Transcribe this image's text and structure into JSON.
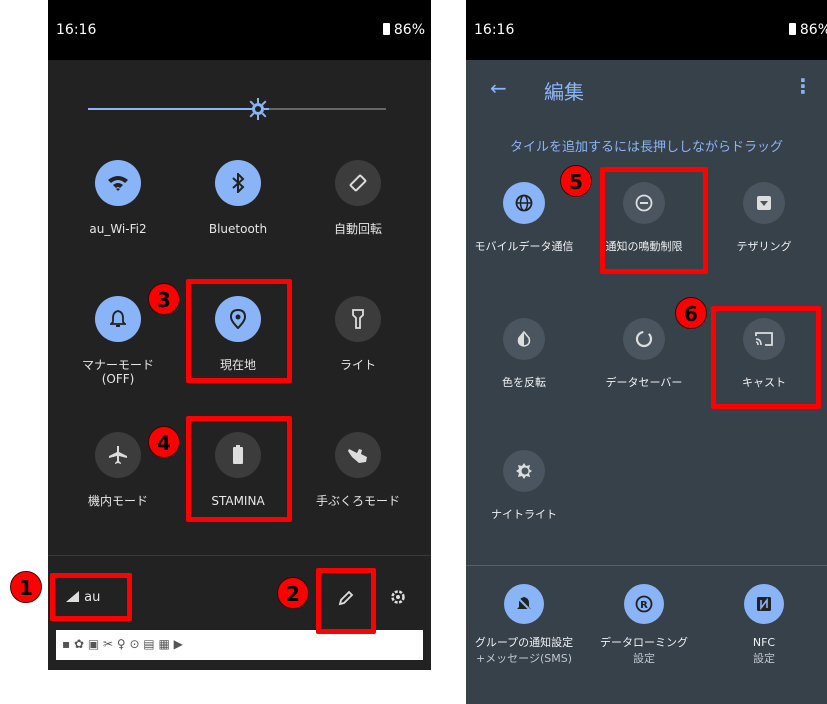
{
  "colors": {
    "accent": "#8ab4f8",
    "highlight": "#ff0000",
    "left_bg": "#222222",
    "right_bg": "#37414a"
  },
  "left_screen": {
    "status": {
      "time": "16:16",
      "battery": "86%"
    },
    "brightness_level_percent": 57,
    "tiles": [
      {
        "label": "au_Wi-Fi2",
        "icon": "wifi-icon",
        "active": true
      },
      {
        "label": "Bluetooth",
        "icon": "bluetooth-icon",
        "active": true
      },
      {
        "label": "自動回転",
        "icon": "auto-rotate-icon",
        "active": false
      },
      {
        "label": "マナーモード",
        "label2": "(OFF)",
        "icon": "bell-icon",
        "active": true
      },
      {
        "label": "現在地",
        "icon": "location-icon",
        "active": true
      },
      {
        "label": "ライト",
        "icon": "flashlight-icon",
        "active": false
      },
      {
        "label": "機内モード",
        "icon": "airplane-icon",
        "active": false
      },
      {
        "label": "STAMINA",
        "icon": "battery-icon",
        "active": false
      },
      {
        "label": "手ぶくろモード",
        "icon": "glove-icon",
        "active": false
      }
    ],
    "carrier": "au",
    "notif_icons": "▪ ✿ ▣ ✂ ♀ ⊙ ▤ ▦ ▶"
  },
  "right_screen": {
    "status": {
      "time": "16:16",
      "battery": "86%"
    },
    "title": "編集",
    "back": "←",
    "menu": "⋮",
    "hint": "タイルを追加するには長押ししながらドラッグ",
    "tiles": [
      {
        "label": "モバイルデータ通信",
        "icon": "globe-icon",
        "active": true
      },
      {
        "label": "通知の鳴動制限",
        "icon": "do-not-disturb-icon",
        "active": false
      },
      {
        "label": "テザリング",
        "icon": "hotspot-icon",
        "active": false
      },
      {
        "label": "色を反転",
        "icon": "invert-colors-icon",
        "active": false
      },
      {
        "label": "データセーバー",
        "icon": "data-saver-icon",
        "active": false
      },
      {
        "label": "キャスト",
        "icon": "cast-icon",
        "active": false
      },
      {
        "label": "ナイトライト",
        "icon": "night-light-icon",
        "active": false
      }
    ],
    "bottom_tiles": [
      {
        "label": "グループの通知設定",
        "sub": "+メッセージ(SMS)",
        "icon": "mute-notification-icon",
        "active": true
      },
      {
        "label": "データローミング",
        "sub": "設定",
        "icon": "roaming-icon",
        "active": true
      },
      {
        "label": "NFC",
        "sub": "設定",
        "icon": "nfc-icon",
        "active": true
      }
    ]
  },
  "markers": [
    "1",
    "2",
    "3",
    "4",
    "5",
    "6"
  ]
}
